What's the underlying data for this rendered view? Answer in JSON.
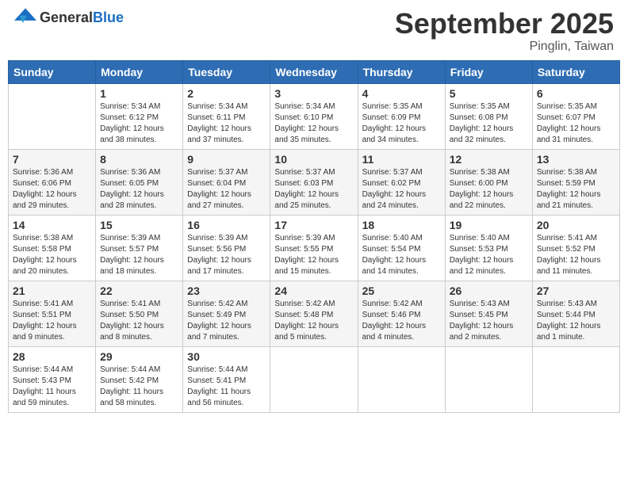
{
  "header": {
    "logo_general": "General",
    "logo_blue": "Blue",
    "month_title": "September 2025",
    "location": "Pinglin, Taiwan"
  },
  "calendar": {
    "weekdays": [
      "Sunday",
      "Monday",
      "Tuesday",
      "Wednesday",
      "Thursday",
      "Friday",
      "Saturday"
    ],
    "weeks": [
      [
        {
          "day": "",
          "info": ""
        },
        {
          "day": "1",
          "info": "Sunrise: 5:34 AM\nSunset: 6:12 PM\nDaylight: 12 hours\nand 38 minutes."
        },
        {
          "day": "2",
          "info": "Sunrise: 5:34 AM\nSunset: 6:11 PM\nDaylight: 12 hours\nand 37 minutes."
        },
        {
          "day": "3",
          "info": "Sunrise: 5:34 AM\nSunset: 6:10 PM\nDaylight: 12 hours\nand 35 minutes."
        },
        {
          "day": "4",
          "info": "Sunrise: 5:35 AM\nSunset: 6:09 PM\nDaylight: 12 hours\nand 34 minutes."
        },
        {
          "day": "5",
          "info": "Sunrise: 5:35 AM\nSunset: 6:08 PM\nDaylight: 12 hours\nand 32 minutes."
        },
        {
          "day": "6",
          "info": "Sunrise: 5:35 AM\nSunset: 6:07 PM\nDaylight: 12 hours\nand 31 minutes."
        }
      ],
      [
        {
          "day": "7",
          "info": "Sunrise: 5:36 AM\nSunset: 6:06 PM\nDaylight: 12 hours\nand 29 minutes."
        },
        {
          "day": "8",
          "info": "Sunrise: 5:36 AM\nSunset: 6:05 PM\nDaylight: 12 hours\nand 28 minutes."
        },
        {
          "day": "9",
          "info": "Sunrise: 5:37 AM\nSunset: 6:04 PM\nDaylight: 12 hours\nand 27 minutes."
        },
        {
          "day": "10",
          "info": "Sunrise: 5:37 AM\nSunset: 6:03 PM\nDaylight: 12 hours\nand 25 minutes."
        },
        {
          "day": "11",
          "info": "Sunrise: 5:37 AM\nSunset: 6:02 PM\nDaylight: 12 hours\nand 24 minutes."
        },
        {
          "day": "12",
          "info": "Sunrise: 5:38 AM\nSunset: 6:00 PM\nDaylight: 12 hours\nand 22 minutes."
        },
        {
          "day": "13",
          "info": "Sunrise: 5:38 AM\nSunset: 5:59 PM\nDaylight: 12 hours\nand 21 minutes."
        }
      ],
      [
        {
          "day": "14",
          "info": "Sunrise: 5:38 AM\nSunset: 5:58 PM\nDaylight: 12 hours\nand 20 minutes."
        },
        {
          "day": "15",
          "info": "Sunrise: 5:39 AM\nSunset: 5:57 PM\nDaylight: 12 hours\nand 18 minutes."
        },
        {
          "day": "16",
          "info": "Sunrise: 5:39 AM\nSunset: 5:56 PM\nDaylight: 12 hours\nand 17 minutes."
        },
        {
          "day": "17",
          "info": "Sunrise: 5:39 AM\nSunset: 5:55 PM\nDaylight: 12 hours\nand 15 minutes."
        },
        {
          "day": "18",
          "info": "Sunrise: 5:40 AM\nSunset: 5:54 PM\nDaylight: 12 hours\nand 14 minutes."
        },
        {
          "day": "19",
          "info": "Sunrise: 5:40 AM\nSunset: 5:53 PM\nDaylight: 12 hours\nand 12 minutes."
        },
        {
          "day": "20",
          "info": "Sunrise: 5:41 AM\nSunset: 5:52 PM\nDaylight: 12 hours\nand 11 minutes."
        }
      ],
      [
        {
          "day": "21",
          "info": "Sunrise: 5:41 AM\nSunset: 5:51 PM\nDaylight: 12 hours\nand 9 minutes."
        },
        {
          "day": "22",
          "info": "Sunrise: 5:41 AM\nSunset: 5:50 PM\nDaylight: 12 hours\nand 8 minutes."
        },
        {
          "day": "23",
          "info": "Sunrise: 5:42 AM\nSunset: 5:49 PM\nDaylight: 12 hours\nand 7 minutes."
        },
        {
          "day": "24",
          "info": "Sunrise: 5:42 AM\nSunset: 5:48 PM\nDaylight: 12 hours\nand 5 minutes."
        },
        {
          "day": "25",
          "info": "Sunrise: 5:42 AM\nSunset: 5:46 PM\nDaylight: 12 hours\nand 4 minutes."
        },
        {
          "day": "26",
          "info": "Sunrise: 5:43 AM\nSunset: 5:45 PM\nDaylight: 12 hours\nand 2 minutes."
        },
        {
          "day": "27",
          "info": "Sunrise: 5:43 AM\nSunset: 5:44 PM\nDaylight: 12 hours\nand 1 minute."
        }
      ],
      [
        {
          "day": "28",
          "info": "Sunrise: 5:44 AM\nSunset: 5:43 PM\nDaylight: 11 hours\nand 59 minutes."
        },
        {
          "day": "29",
          "info": "Sunrise: 5:44 AM\nSunset: 5:42 PM\nDaylight: 11 hours\nand 58 minutes."
        },
        {
          "day": "30",
          "info": "Sunrise: 5:44 AM\nSunset: 5:41 PM\nDaylight: 11 hours\nand 56 minutes."
        },
        {
          "day": "",
          "info": ""
        },
        {
          "day": "",
          "info": ""
        },
        {
          "day": "",
          "info": ""
        },
        {
          "day": "",
          "info": ""
        }
      ]
    ]
  }
}
